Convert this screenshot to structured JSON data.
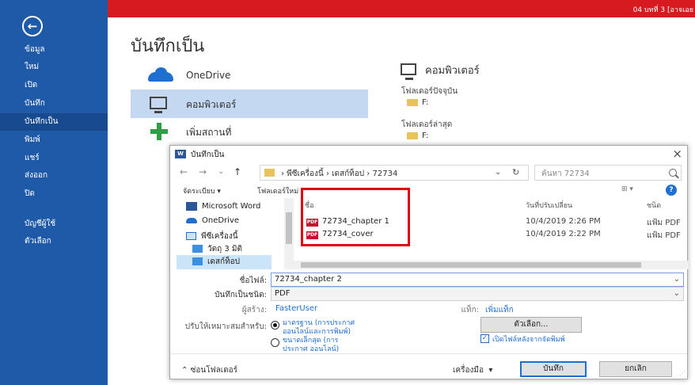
{
  "window": {
    "doc_title": "04 บทที่ 3 [อาจเอย"
  },
  "sidebar": {
    "back_icon": "back-arrow-icon",
    "items": [
      {
        "label": "ข้อมูล"
      },
      {
        "label": "ใหม่"
      },
      {
        "label": "เปิด"
      },
      {
        "label": "บันทึก"
      },
      {
        "label": "บันทึกเป็น",
        "active": true
      },
      {
        "label": "พิมพ์"
      },
      {
        "label": "แชร์"
      },
      {
        "label": "ส่งออก"
      },
      {
        "label": "ปิด"
      },
      {
        "label": "บัญชีผู้ใช้"
      },
      {
        "label": "ตัวเลือก"
      }
    ]
  },
  "backstage": {
    "title": "บันทึกเป็น",
    "locations": [
      {
        "label": "OneDrive",
        "icon": "onedrive-icon"
      },
      {
        "label": "คอมพิวเตอร์",
        "icon": "computer-icon",
        "selected": true
      },
      {
        "label": "เพิ่มสถานที่",
        "icon": "add-place-icon"
      }
    ],
    "right_panel": {
      "heading": "คอมพิวเตอร์",
      "current_folder_label": "โฟลเดอร์ปัจจุบัน",
      "current_folder": "F:",
      "recent_folder_label": "โฟลเดอร์ล่าสุด",
      "recent_folder": "F:"
    }
  },
  "dialog": {
    "title": "บันทึกเป็น",
    "close": "×",
    "nav": {
      "back": "←",
      "forward": "→",
      "recent": "⌄",
      "up": "↑",
      "breadcrumb": "›  พีซีเครื่องนี้  ›  เดสก์ท็อป  ›  72734",
      "dropdown": "⌄",
      "refresh": "↻",
      "search_placeholder": "ค้นหา 72734"
    },
    "toolbar": {
      "organize": "จัดระเบียบ ▾",
      "new_folder": "โฟลเดอร์ใหม่",
      "view": "⊞ ▾",
      "help": "?"
    },
    "nav_pane": [
      {
        "label": "Microsoft Word",
        "icon": "word-icon"
      },
      {
        "label": "OneDrive",
        "icon": "onedrive-icon"
      },
      {
        "label": "พีซีเครื่องนี้",
        "icon": "this-pc-icon"
      },
      {
        "label": "วัตถุ 3 มิติ",
        "icon": "3d-objects-icon"
      },
      {
        "label": "เดสก์ท็อป",
        "icon": "desktop-icon",
        "selected": true
      }
    ],
    "columns": {
      "name": "ชื่อ",
      "modified": "วันที่ปรับเปลี่ยน",
      "type": "ชนิด"
    },
    "files": [
      {
        "name": "72734_chapter 1",
        "modified": "10/4/2019 2:26 PM",
        "type": "แฟ้ม PDF"
      },
      {
        "name": "72734_cover",
        "modified": "10/4/2019 2:22 PM",
        "type": "แฟ้ม PDF"
      }
    ],
    "form": {
      "filename_label": "ชื่อไฟล์:",
      "filename_value": "72734_chapter 2",
      "filetype_label": "บันทึกเป็นชนิด:",
      "filetype_value": "PDF",
      "author_label": "ผู้สร้าง:",
      "author_value": "FasterUser",
      "tags_label": "แท็ก:",
      "tags_value": "เพิ่มแท็ก",
      "optimize_label": "ปรับให้เหมาะสมสำหรับ:",
      "radio_standard": "มาตรฐาน (การประกาศ ออนไลน์และการพิมพ์)",
      "radio_minimum": "ขนาดเล็กสุด (การประกาศ ออนไลน์)",
      "options_button": "ตัวเลือก...",
      "open_after_label": "เปิดไฟล์หลังจากจัดพิมพ์",
      "open_after_checked": true
    },
    "bottom": {
      "hide_folders": "ซ่อนโฟลเดอร์",
      "tools": "เครื่องมือ",
      "save": "บันทึก",
      "cancel": "ยกเลิก"
    }
  },
  "colors": {
    "sidebar_bg": "#1e5aa8",
    "topbar_bg": "#d71920",
    "selected_location_bg": "#c5d8f2",
    "highlight_box": "#e3000f"
  }
}
